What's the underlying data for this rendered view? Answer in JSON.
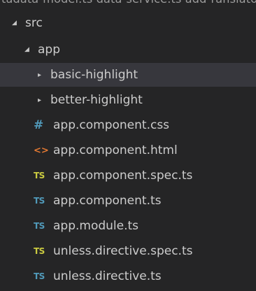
{
  "explorer": {
    "top_strip_text": "tadata-model.ts data-service.ts add-ranslator.ts"
  },
  "tree": {
    "root": {
      "label": "src",
      "expanded": true
    },
    "app": {
      "label": "app",
      "expanded": true
    },
    "folders": [
      {
        "label": "basic-highlight",
        "expanded": false
      },
      {
        "label": "better-highlight",
        "expanded": false
      }
    ],
    "files": [
      {
        "label": "app.component.css",
        "icon": "#",
        "icon_type": "css-file-icon",
        "color": "#519aba"
      },
      {
        "label": "app.component.html",
        "icon": "<>",
        "icon_type": "html-file-icon",
        "color": "#e37933"
      },
      {
        "label": "app.component.spec.ts",
        "icon": "TS",
        "icon_type": "ts-spec-file-icon",
        "color": "#cbcb41"
      },
      {
        "label": "app.component.ts",
        "icon": "TS",
        "icon_type": "ts-file-icon",
        "color": "#519aba"
      },
      {
        "label": "app.module.ts",
        "icon": "TS",
        "icon_type": "ts-file-icon",
        "color": "#519aba"
      },
      {
        "label": "unless.directive.spec.ts",
        "icon": "TS",
        "icon_type": "ts-spec-file-icon",
        "color": "#cbcb41"
      },
      {
        "label": "unless.directive.ts",
        "icon": "TS",
        "icon_type": "ts-file-icon",
        "color": "#519aba"
      }
    ]
  },
  "glyphs": {
    "expanded_twisty": "◢",
    "collapsed_twisty": "▸"
  },
  "colors": {
    "background": "#252526",
    "selected_row": "#37373d",
    "text": "#cccccc"
  }
}
